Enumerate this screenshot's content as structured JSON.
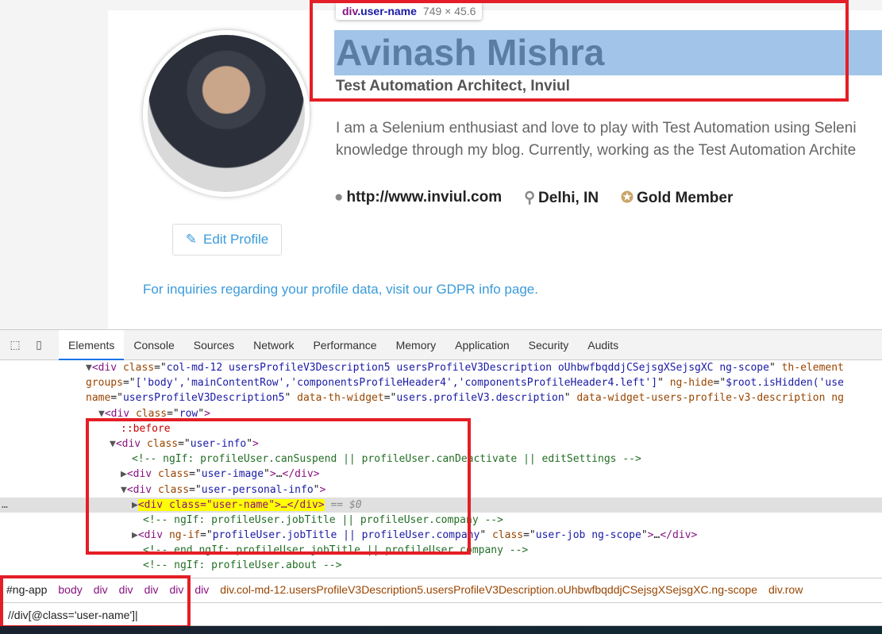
{
  "profile": {
    "name": "Avinash Mishra",
    "job": "Test Automation Architect, Inviul",
    "about_lines": [
      "I am a Selenium enthusiast and love to play with Test Automation using Seleni",
      "knowledge through my blog. Currently, working as the Test Automation Archite"
    ],
    "website": "http://www.inviul.com",
    "location": "Delhi, IN",
    "membership": "Gold Member",
    "edit_label": "Edit Profile",
    "gdpr_text": "For inquiries regarding your profile data, visit our GDPR info page."
  },
  "tooltip": {
    "tag": "div",
    "cls": ".user-name",
    "dims": "749 × 45.6"
  },
  "devtools": {
    "tabs": [
      "Elements",
      "Console",
      "Sources",
      "Network",
      "Performance",
      "Memory",
      "Application",
      "Security",
      "Audits"
    ],
    "active_tab": "Elements",
    "code_lines": [
      {
        "indent": 108,
        "tokens": [
          [
            "arrow",
            "▼"
          ],
          [
            "tag",
            "<div "
          ],
          [
            "attr",
            "class"
          ],
          [
            "txt",
            "=\""
          ],
          [
            "val",
            "col-md-12 usersProfileV3Description5 usersProfileV3Description oUhbwfbqddjCSejsgXSejsgXC ng-scope"
          ],
          [
            "txt",
            "\" "
          ],
          [
            "attr",
            "th-element"
          ]
        ]
      },
      {
        "indent": 108,
        "tokens": [
          [
            "attr",
            "groups"
          ],
          [
            "txt",
            "=\""
          ],
          [
            "val",
            "['body','mainContentRow','componentsProfileHeader4','componentsProfileHeader4.left']"
          ],
          [
            "txt",
            "\" "
          ],
          [
            "attr",
            "ng-hide"
          ],
          [
            "txt",
            "=\""
          ],
          [
            "val",
            "$root.isHidden('use"
          ]
        ]
      },
      {
        "indent": 108,
        "tokens": [
          [
            "attr",
            "name"
          ],
          [
            "txt",
            "=\""
          ],
          [
            "val",
            "usersProfileV3Description5"
          ],
          [
            "txt",
            "\" "
          ],
          [
            "attr",
            "data-th-widget"
          ],
          [
            "txt",
            "=\""
          ],
          [
            "val",
            "users.profileV3.description"
          ],
          [
            "txt",
            "\" "
          ],
          [
            "attr",
            "data-widget-users-profile-v3-description ng"
          ]
        ]
      },
      {
        "indent": 124,
        "tokens": [
          [
            "arrow",
            "▼"
          ],
          [
            "tag",
            "<div "
          ],
          [
            "attr",
            "class"
          ],
          [
            "txt",
            "=\""
          ],
          [
            "val",
            "row"
          ],
          [
            "txt",
            "\""
          ],
          [
            "tag",
            ">"
          ]
        ]
      },
      {
        "indent": 152,
        "tokens": [
          [
            "pseudo",
            "::before"
          ]
        ]
      },
      {
        "indent": 138,
        "tokens": [
          [
            "arrow",
            "▼"
          ],
          [
            "tag",
            "<div "
          ],
          [
            "attr",
            "class"
          ],
          [
            "txt",
            "=\""
          ],
          [
            "val",
            "user-info"
          ],
          [
            "txt",
            "\""
          ],
          [
            "tag",
            ">"
          ]
        ]
      },
      {
        "indent": 166,
        "tokens": [
          [
            "com",
            "<!-- ngIf: profileUser.canSuspend || profileUser.canDeactivate || editSettings -->"
          ]
        ]
      },
      {
        "indent": 152,
        "tokens": [
          [
            "arrow",
            "▶"
          ],
          [
            "tag",
            "<div "
          ],
          [
            "attr",
            "class"
          ],
          [
            "txt",
            "=\""
          ],
          [
            "val",
            "user-image"
          ],
          [
            "txt",
            "\""
          ],
          [
            "tag",
            ">"
          ],
          [
            "txt",
            "…"
          ],
          [
            "tag",
            "</div>"
          ]
        ]
      },
      {
        "indent": 152,
        "tokens": [
          [
            "arrow",
            "▼"
          ],
          [
            "tag",
            "<div "
          ],
          [
            "attr",
            "class"
          ],
          [
            "txt",
            "=\""
          ],
          [
            "val",
            "user-personal-info"
          ],
          [
            "txt",
            "\""
          ],
          [
            "tag",
            ">"
          ]
        ]
      },
      {
        "indent": 166,
        "selected": true,
        "tokens": [
          [
            "arrow",
            "▶"
          ],
          [
            "hl",
            "<div class=\"user-name\">…</div>"
          ],
          [
            "sel",
            " == $0"
          ]
        ]
      },
      {
        "indent": 180,
        "tokens": [
          [
            "com",
            "<!-- ngIf: profileUser.jobTitle || profileUser.company -->"
          ]
        ]
      },
      {
        "indent": 166,
        "tokens": [
          [
            "arrow",
            "▶"
          ],
          [
            "tag",
            "<div "
          ],
          [
            "attr",
            "ng-if"
          ],
          [
            "txt",
            "=\""
          ],
          [
            "val",
            "profileUser.jobTitle || profileUser.company"
          ],
          [
            "txt",
            "\" "
          ],
          [
            "attr",
            "class"
          ],
          [
            "txt",
            "=\""
          ],
          [
            "val",
            "user-job ng-scope"
          ],
          [
            "txt",
            "\""
          ],
          [
            "tag",
            ">"
          ],
          [
            "txt",
            "…"
          ],
          [
            "tag",
            "</div>"
          ]
        ]
      },
      {
        "indent": 180,
        "tokens": [
          [
            "com",
            "<!-- end ngIf: profileUser.jobTitle || profileUser.company -->"
          ]
        ]
      },
      {
        "indent": 180,
        "tokens": [
          [
            "com",
            "<!-- ngIf: profileUser.about -->"
          ]
        ]
      }
    ],
    "breadcrumbs": [
      "#ng-app",
      "body",
      "div",
      "div",
      "div",
      "div",
      "div",
      "div.col-md-12.usersProfileV3Description5.usersProfileV3Description.oUhbwfbqddjCSejsgXSejsgXC.ng-scope",
      "div.row"
    ],
    "search_value": "//div[@class='user-name']"
  },
  "colors": {
    "highlight_box": "#e41e26",
    "link": "#3a9bd9",
    "selection": "#a1c4e8"
  }
}
